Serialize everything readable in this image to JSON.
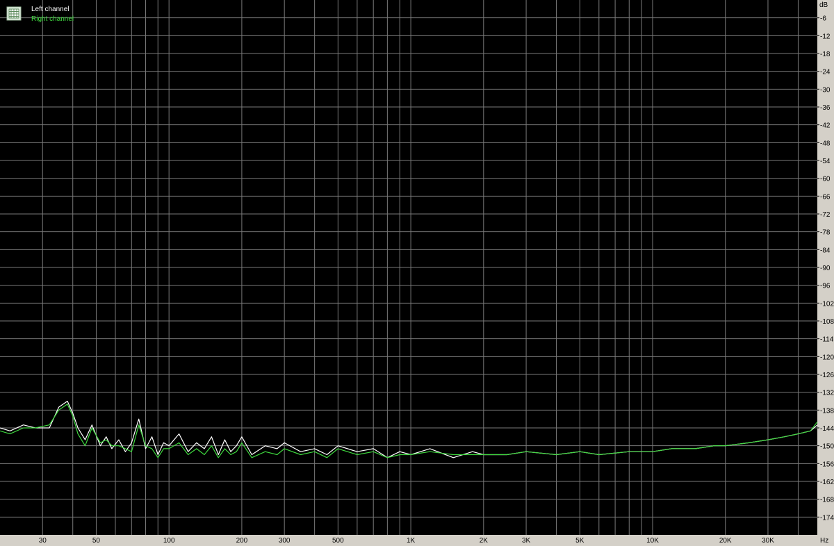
{
  "chart_data": {
    "type": "line",
    "xscale": "log",
    "xlim": [
      20,
      48000
    ],
    "ylim": [
      -180,
      0
    ],
    "yticks": [
      -6,
      -12,
      -18,
      -24,
      -30,
      -36,
      -42,
      -48,
      -54,
      -60,
      -66,
      -72,
      -78,
      -84,
      -90,
      -96,
      -102,
      -108,
      -114,
      -120,
      -126,
      -132,
      -138,
      -144,
      -150,
      -156,
      -162,
      -168,
      -174
    ],
    "xticks": [
      {
        "value": 30,
        "label": "30"
      },
      {
        "value": 50,
        "label": "50"
      },
      {
        "value": 100,
        "label": "100"
      },
      {
        "value": 200,
        "label": "200"
      },
      {
        "value": 300,
        "label": "300"
      },
      {
        "value": 500,
        "label": "500"
      },
      {
        "value": 1000,
        "label": "1K"
      },
      {
        "value": 2000,
        "label": "2K"
      },
      {
        "value": 3000,
        "label": "3K"
      },
      {
        "value": 5000,
        "label": "5K"
      },
      {
        "value": 10000,
        "label": "10K"
      },
      {
        "value": 20000,
        "label": "20K"
      },
      {
        "value": 30000,
        "label": "30K"
      }
    ],
    "ylabel_unit": "dB",
    "xlabel_unit": "Hz",
    "grid": true,
    "legend_placement": "top-left",
    "background": "#000000",
    "grid_color": "#7a7a7a",
    "series": [
      {
        "name": "Left channel",
        "color": "#ffffff",
        "x": [
          20,
          22,
          25,
          28,
          32,
          35,
          38,
          40,
          42,
          45,
          48,
          52,
          55,
          58,
          62,
          66,
          70,
          75,
          80,
          85,
          90,
          95,
          100,
          110,
          120,
          130,
          140,
          150,
          160,
          170,
          180,
          190,
          200,
          220,
          250,
          280,
          300,
          350,
          400,
          450,
          500,
          600,
          700,
          800,
          900,
          1000,
          1200,
          1500,
          1800,
          2000,
          2500,
          3000,
          4000,
          5000,
          6000,
          8000,
          10000,
          12000,
          15000,
          18000,
          20000,
          25000,
          30000,
          35000,
          40000,
          45000,
          48000
        ],
        "y": [
          -144,
          -145,
          -143,
          -144,
          -144,
          -137,
          -135,
          -139,
          -144,
          -148,
          -143,
          -150,
          -147,
          -151,
          -148,
          -152,
          -149,
          -141,
          -151,
          -147,
          -153,
          -149,
          -150,
          -146,
          -152,
          -149,
          -151,
          -147,
          -153,
          -148,
          -152,
          -150,
          -147,
          -153,
          -150,
          -151,
          -149,
          -152,
          -151,
          -153,
          -150,
          -152,
          -151,
          -154,
          -152,
          -153,
          -151,
          -154,
          -152,
          -153,
          -153,
          -152,
          -153,
          -152,
          -153,
          -152,
          -152,
          -151,
          -151,
          -150,
          -150,
          -149,
          -148,
          -147,
          -146,
          -145,
          -143
        ]
      },
      {
        "name": "Right channel",
        "color": "#3ed83e",
        "x": [
          20,
          22,
          25,
          28,
          32,
          35,
          38,
          40,
          42,
          45,
          48,
          52,
          55,
          58,
          62,
          66,
          70,
          75,
          80,
          85,
          90,
          95,
          100,
          110,
          120,
          130,
          140,
          150,
          160,
          170,
          180,
          190,
          200,
          220,
          250,
          280,
          300,
          350,
          400,
          450,
          500,
          600,
          700,
          800,
          900,
          1000,
          1200,
          1500,
          1800,
          2000,
          2500,
          3000,
          4000,
          5000,
          6000,
          8000,
          10000,
          12000,
          15000,
          18000,
          20000,
          25000,
          30000,
          35000,
          40000,
          45000,
          48000
        ],
        "y": [
          -145,
          -146,
          -144,
          -144,
          -143,
          -138,
          -136,
          -140,
          -146,
          -150,
          -144,
          -149,
          -148,
          -150,
          -150,
          -151,
          -152,
          -143,
          -150,
          -151,
          -154,
          -151,
          -151,
          -149,
          -153,
          -151,
          -153,
          -150,
          -154,
          -151,
          -153,
          -152,
          -149,
          -154,
          -152,
          -153,
          -151,
          -153,
          -152,
          -154,
          -151,
          -153,
          -152,
          -154,
          -153,
          -153,
          -152,
          -153,
          -153,
          -153,
          -153,
          -152,
          -153,
          -152,
          -153,
          -152,
          -152,
          -151,
          -151,
          -150,
          -150,
          -149,
          -148,
          -147,
          -146,
          -145,
          -142
        ]
      }
    ]
  }
}
